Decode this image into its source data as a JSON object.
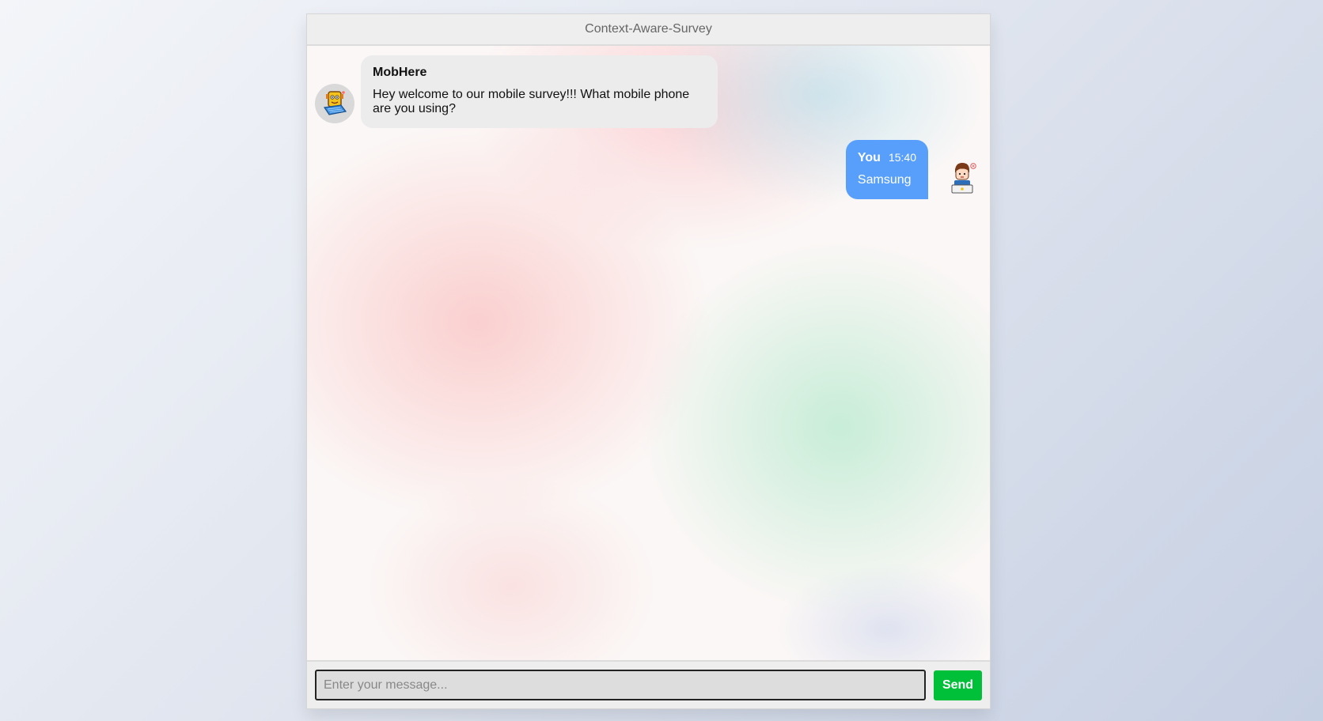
{
  "header": {
    "title": "Context-Aware-Survey"
  },
  "messages": [
    {
      "side": "left",
      "name": "MobHere",
      "time": "",
      "text": "Hey welcome to our mobile survey!!! What mobile phone are you using?",
      "avatar_icon": "robot-laptop-icon"
    },
    {
      "side": "right",
      "name": "You",
      "time": "15:40",
      "text": "Samsung",
      "avatar_icon": "user-laptop-icon"
    }
  ],
  "input": {
    "placeholder": "Enter your message...",
    "value": ""
  },
  "send_button": {
    "label": "Send"
  },
  "colors": {
    "user_bubble": "#579ffb",
    "bot_bubble": "#ececec",
    "send_button": "#00c03a"
  }
}
